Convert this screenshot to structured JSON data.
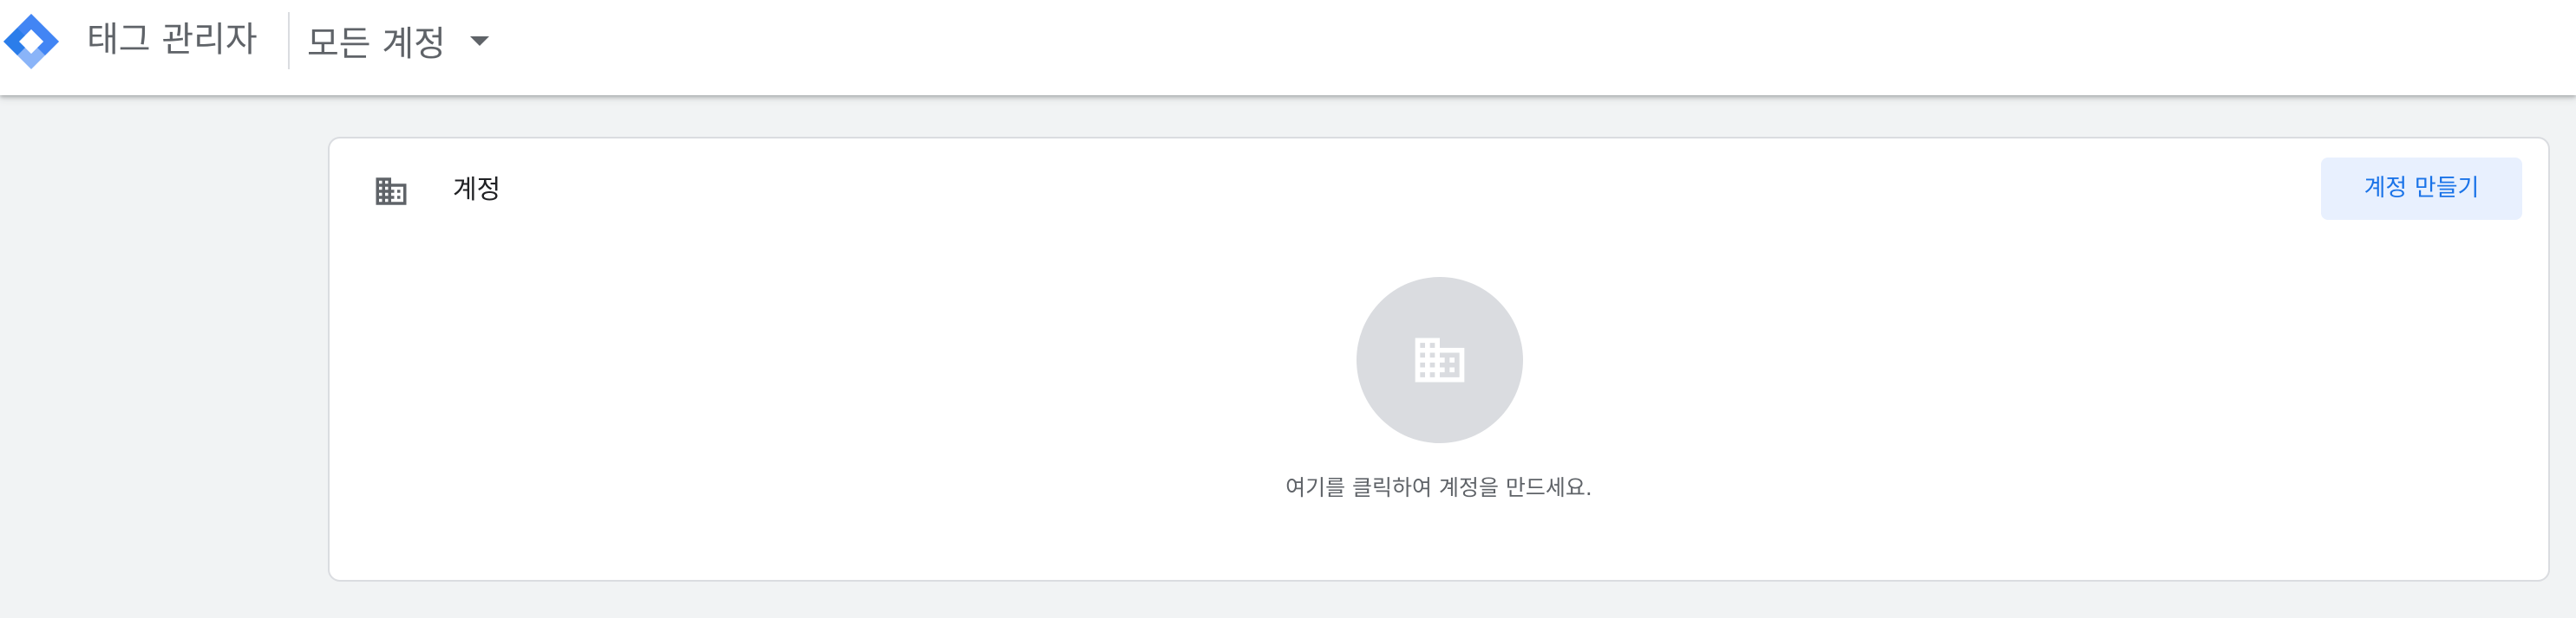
{
  "header": {
    "product_name": "태그 관리자",
    "account_selector_label": "모든 계정",
    "logo_icon": "tag-manager-logo-icon",
    "caret_icon": "caret-down-icon"
  },
  "accounts_card": {
    "title": "계정",
    "title_icon": "building-icon",
    "create_button_label": "계정 만들기",
    "empty_icon": "building-icon",
    "empty_message": "여기를 클릭하여 계정을 만드세요."
  },
  "colors": {
    "accent": "#1a73e8",
    "button_bg": "#e8f0fe",
    "page_bg": "#f1f3f4",
    "muted_text": "#5f6368"
  }
}
